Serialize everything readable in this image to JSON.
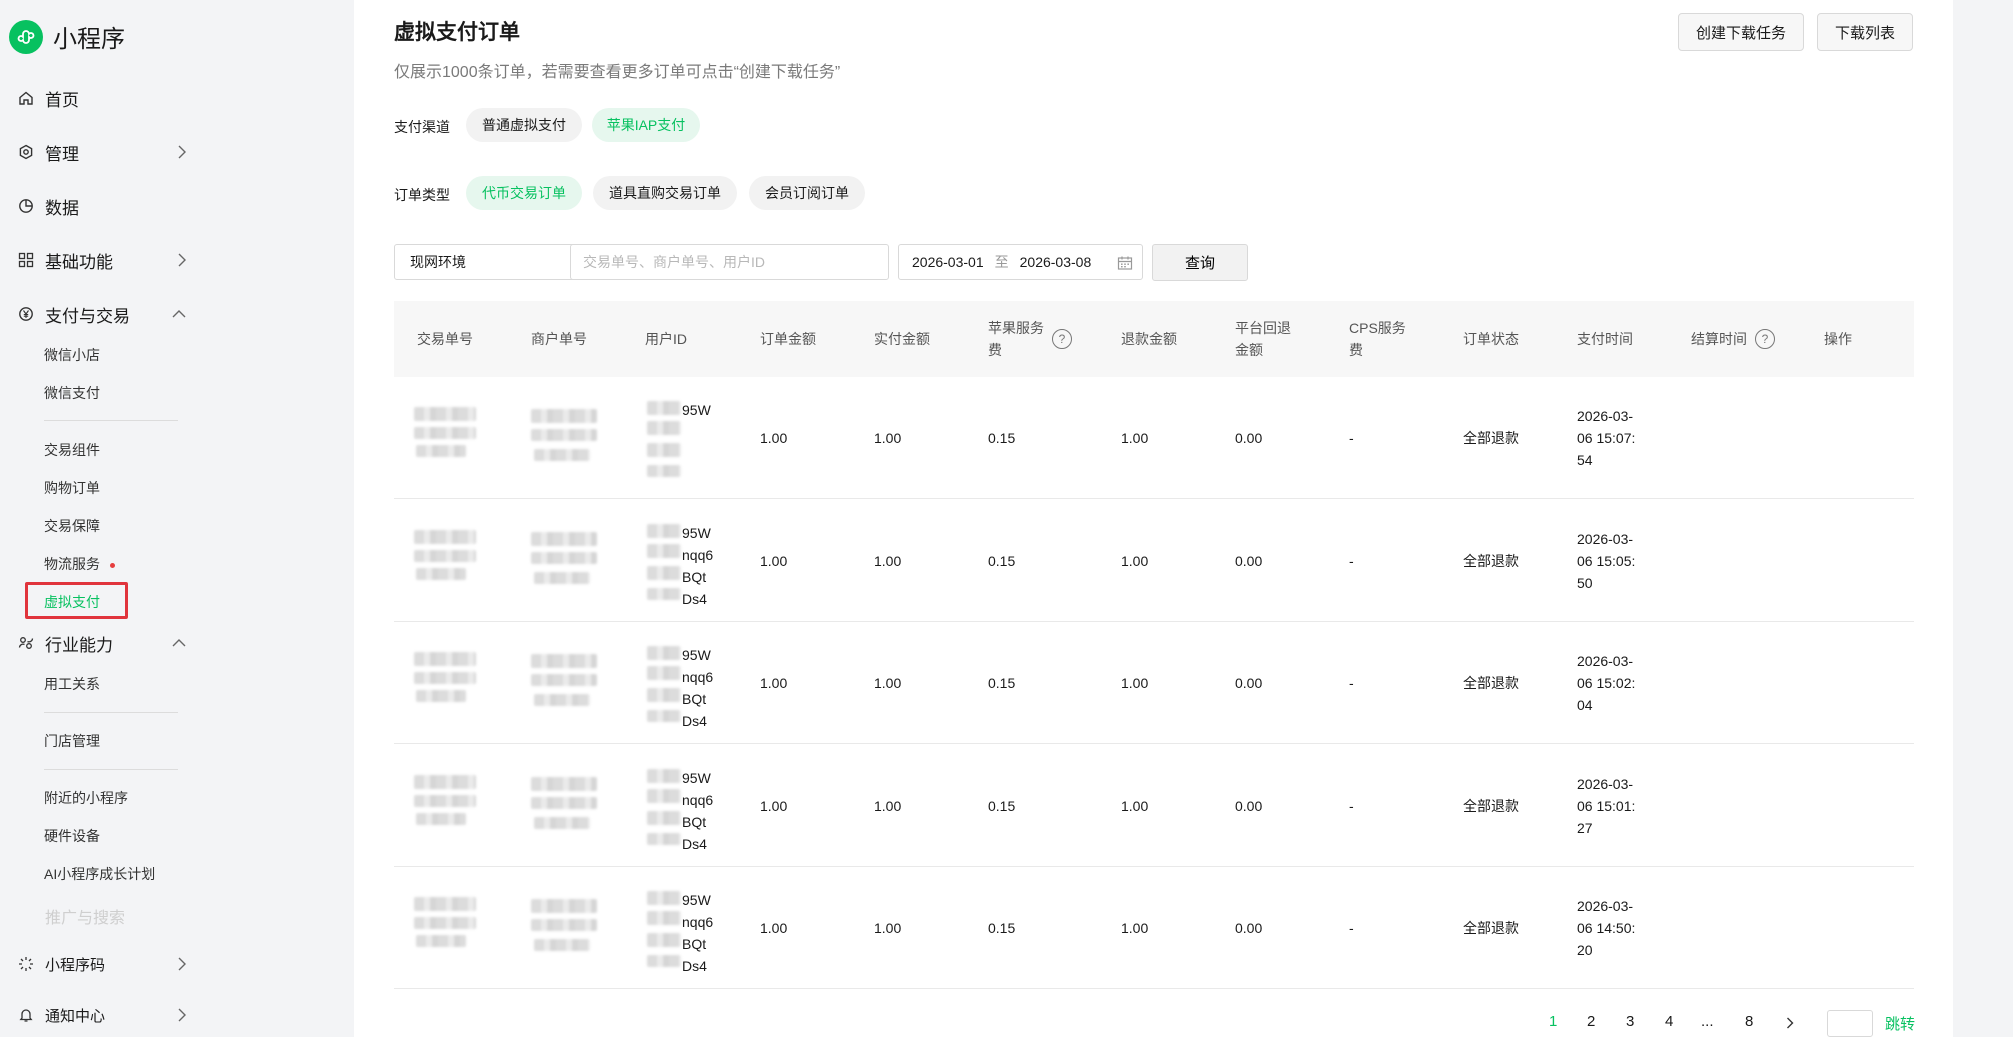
{
  "app": {
    "title": "小程序"
  },
  "sidebar": {
    "home": "首页",
    "manage": "管理",
    "data": "数据",
    "basic": "基础功能",
    "pay": "支付与交易",
    "pay_items": [
      "微信小店",
      "微信支付",
      "交易组件",
      "购物订单",
      "交易保障",
      "物流服务",
      "虚拟支付"
    ],
    "industry": "行业能力",
    "industry_items": [
      "用工关系",
      "门店管理",
      "附近的小程序",
      "硬件设备",
      "AI小程序成长计划"
    ],
    "faded": "推广与搜索",
    "code": "小程序码",
    "notify": "通知中心"
  },
  "page": {
    "title": "虚拟支付订单",
    "desc": "仅展示1000条订单，若需要查看更多订单可点击“创建下载任务”",
    "btn_create": "创建下载任务",
    "btn_list": "下载列表"
  },
  "filters": {
    "channel_label": "支付渠道",
    "channels": [
      "普通虚拟支付",
      "苹果IAP支付"
    ],
    "type_label": "订单类型",
    "types": [
      "代币交易订单",
      "道具直购交易订单",
      "会员订阅订单"
    ],
    "env": "现网环境",
    "search_placeholder": "交易单号、商户单号、用户ID",
    "date_from": "2026-03-01",
    "date_sep": "至",
    "date_to": "2026-03-08",
    "query": "查询"
  },
  "table": {
    "headers": {
      "tx": "交易单号",
      "merchant": "商户单号",
      "uid": "用户ID",
      "amount": "订单金额",
      "paid": "实付金额",
      "apple_fee_1": "苹果服务",
      "apple_fee_2": "费",
      "refund": "退款金额",
      "platform_1": "平台回退",
      "platform_2": "金额",
      "cps_1": "CPS服务",
      "cps_2": "费",
      "status": "订单状态",
      "pay_time": "支付时间",
      "settle_time": "结算时间",
      "action": "操作"
    },
    "rows": [
      {
        "uid_tail": [
          "95W",
          "",
          "",
          ""
        ],
        "amount": "1.00",
        "paid": "1.00",
        "apple_fee": "0.15",
        "refund": "1.00",
        "platform": "0.00",
        "cps": "-",
        "status": "全部退款",
        "pay_time": [
          "2026-03-",
          "06 15:07:",
          "54"
        ]
      },
      {
        "uid_tail": [
          "95W",
          "nqq6",
          "BQt",
          "Ds4"
        ],
        "amount": "1.00",
        "paid": "1.00",
        "apple_fee": "0.15",
        "refund": "1.00",
        "platform": "0.00",
        "cps": "-",
        "status": "全部退款",
        "pay_time": [
          "2026-03-",
          "06 15:05:",
          "50"
        ]
      },
      {
        "uid_tail": [
          "95W",
          "nqq6",
          "BQt",
          "Ds4"
        ],
        "amount": "1.00",
        "paid": "1.00",
        "apple_fee": "0.15",
        "refund": "1.00",
        "platform": "0.00",
        "cps": "-",
        "status": "全部退款",
        "pay_time": [
          "2026-03-",
          "06 15:02:",
          "04"
        ]
      },
      {
        "uid_tail": [
          "95W",
          "nqq6",
          "BQt",
          "Ds4"
        ],
        "amount": "1.00",
        "paid": "1.00",
        "apple_fee": "0.15",
        "refund": "1.00",
        "platform": "0.00",
        "cps": "-",
        "status": "全部退款",
        "pay_time": [
          "2026-03-",
          "06 15:01:",
          "27"
        ]
      },
      {
        "uid_tail": [
          "95W",
          "nqq6",
          "BQt",
          "Ds4"
        ],
        "amount": "1.00",
        "paid": "1.00",
        "apple_fee": "0.15",
        "refund": "1.00",
        "platform": "0.00",
        "cps": "-",
        "status": "全部退款",
        "pay_time": [
          "2026-03-",
          "06 14:50:",
          "20"
        ]
      }
    ]
  },
  "pagination": {
    "pages": [
      "1",
      "2",
      "3",
      "4",
      "...",
      "8"
    ],
    "current": "1",
    "jump": "跳转"
  },
  "colors": {
    "accent": "#07c160",
    "highlight": "#e0343c"
  }
}
